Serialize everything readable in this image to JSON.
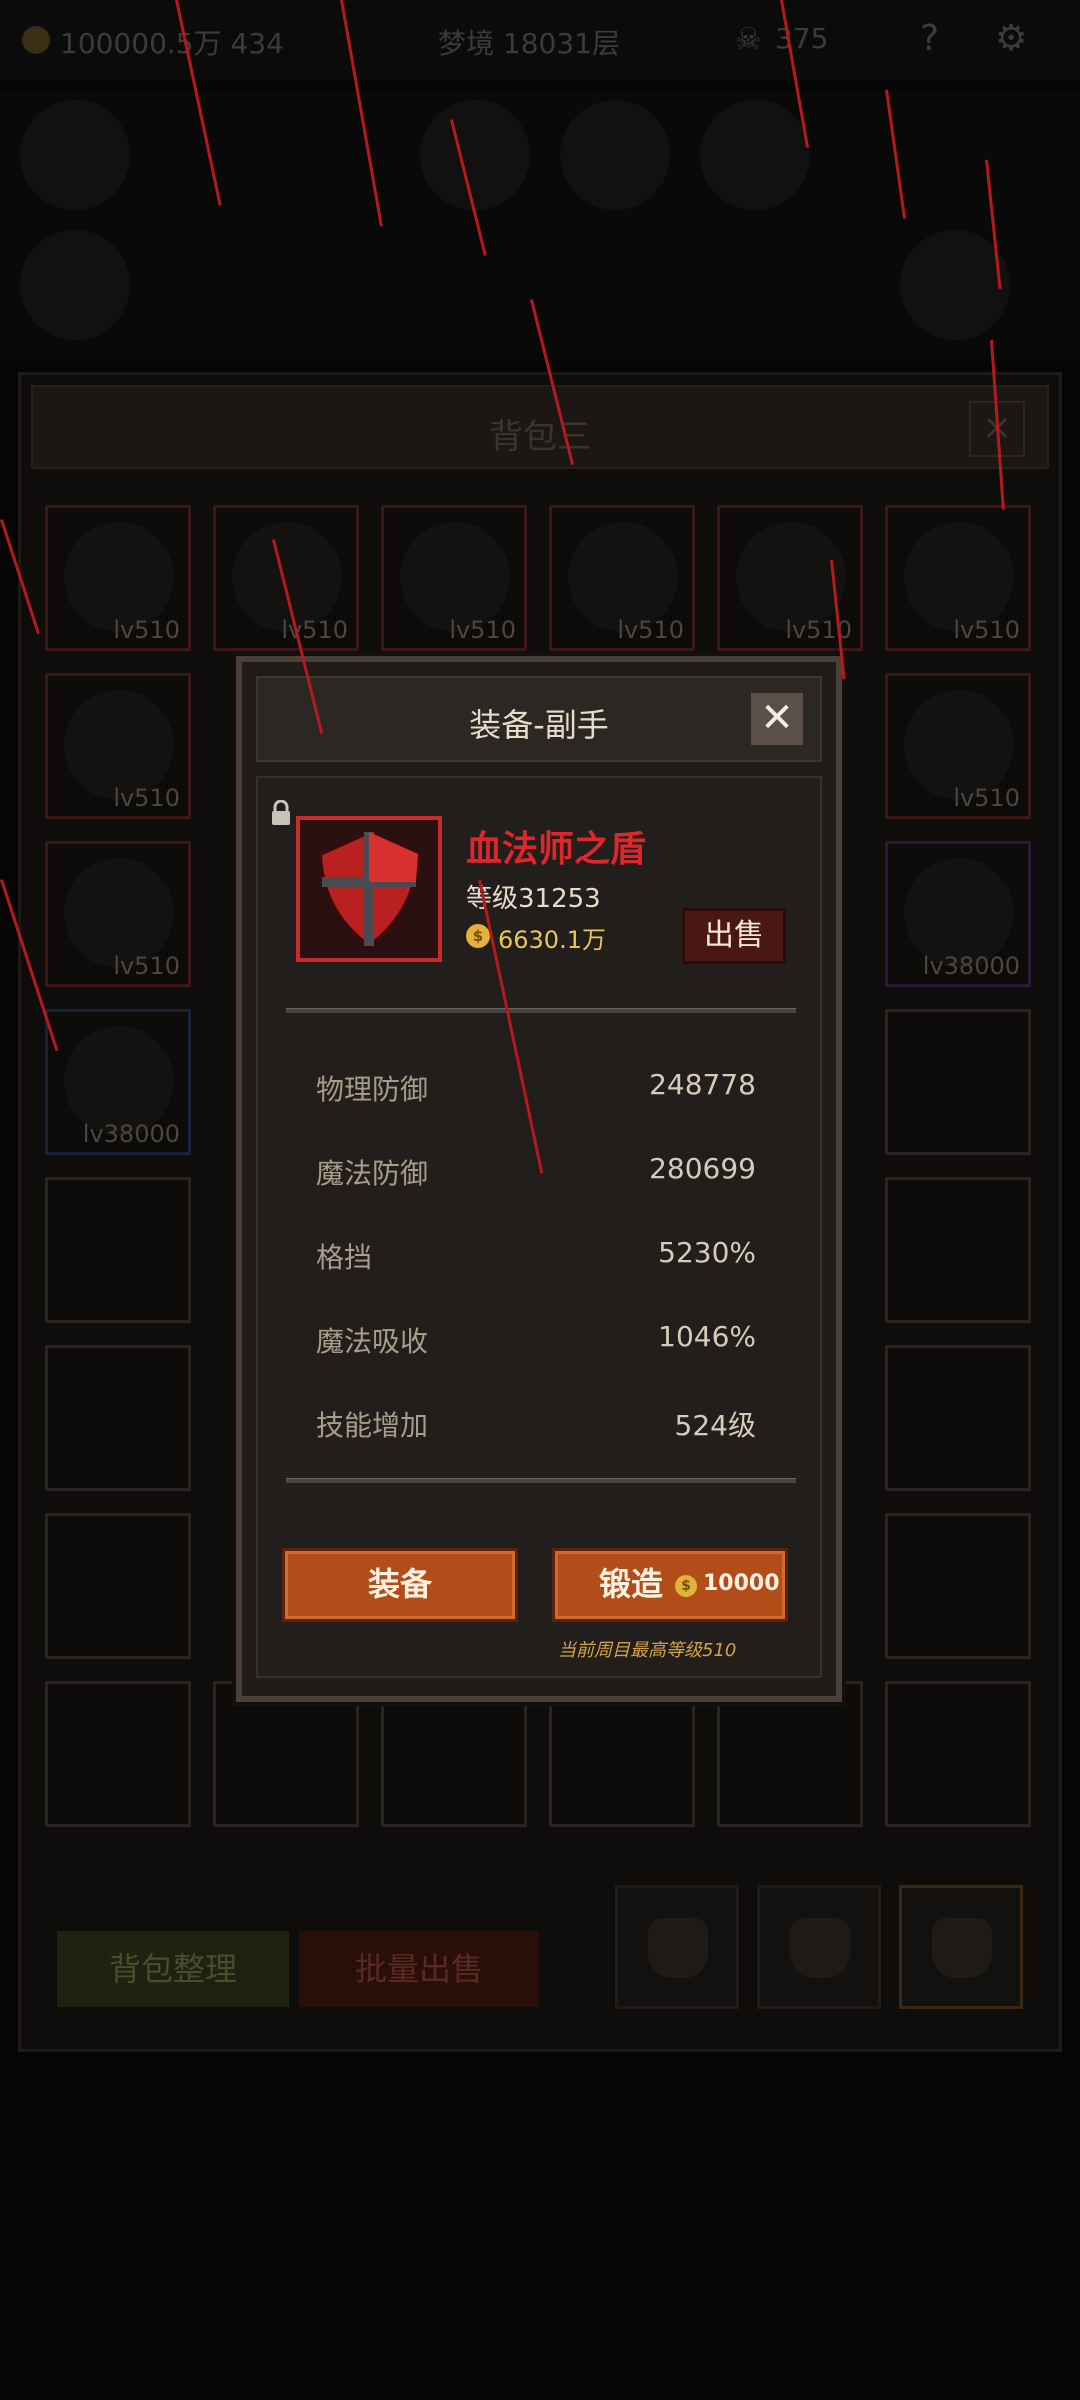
{
  "topbar": {
    "gold": "100000.5万 434",
    "stage": "梦境 18031层",
    "skull_value": "375",
    "help_icon": "question-icon",
    "settings_icon": "gear-icon"
  },
  "bag": {
    "title": "背包三",
    "close_label": "×",
    "slots": [
      {
        "level": "lv510",
        "rarity": "red",
        "art": "staff-icon"
      },
      {
        "level": "lv510",
        "rarity": "red",
        "art": "pendulum-icon"
      },
      {
        "level": "lv510",
        "rarity": "red",
        "art": "pendulum-icon"
      },
      {
        "level": "lv510",
        "rarity": "red",
        "art": "gem-necklace-icon"
      },
      {
        "level": "lv510",
        "rarity": "red",
        "art": "ring-icon"
      },
      {
        "level": "lv510",
        "rarity": "red",
        "art": "ring-icon"
      },
      {
        "level": "lv510",
        "rarity": "red",
        "art": "ring-icon"
      },
      {
        "level": "lv510",
        "rarity": "red",
        "art": "ring-icon"
      },
      {
        "level": "lv510",
        "rarity": "red",
        "art": "ring-icon"
      },
      {
        "level": "lv38000",
        "rarity": "purple",
        "art": "orb-icon"
      },
      {
        "level": "lv38000",
        "rarity": "blue",
        "art": "ring-icon"
      }
    ],
    "sort_label": "背包整理",
    "bulk_sell_label": "批量出售"
  },
  "modal": {
    "title": "装备-副手",
    "close_label": "✕",
    "item": {
      "name": "血法师之盾",
      "level_text": "等级31253",
      "price": "6630.1万",
      "coin_symbol": "$",
      "icon": "shield-icon"
    },
    "sell_label": "出售",
    "stats": [
      {
        "label": "物理防御",
        "value": "248778"
      },
      {
        "label": "魔法防御",
        "value": "280699"
      },
      {
        "label": "格挡",
        "value": "5230%"
      },
      {
        "label": "魔法吸收",
        "value": "1046%"
      },
      {
        "label": "技能增加",
        "value": "524级"
      }
    ],
    "equip_label": "装备",
    "forge_label": "锻造",
    "forge_cost": "10000",
    "forge_note": "当前周目最高等级510"
  },
  "colors": {
    "item_name": "#e0262b",
    "button_orange": "#b24d1a",
    "price_gold": "#e8c45a"
  }
}
